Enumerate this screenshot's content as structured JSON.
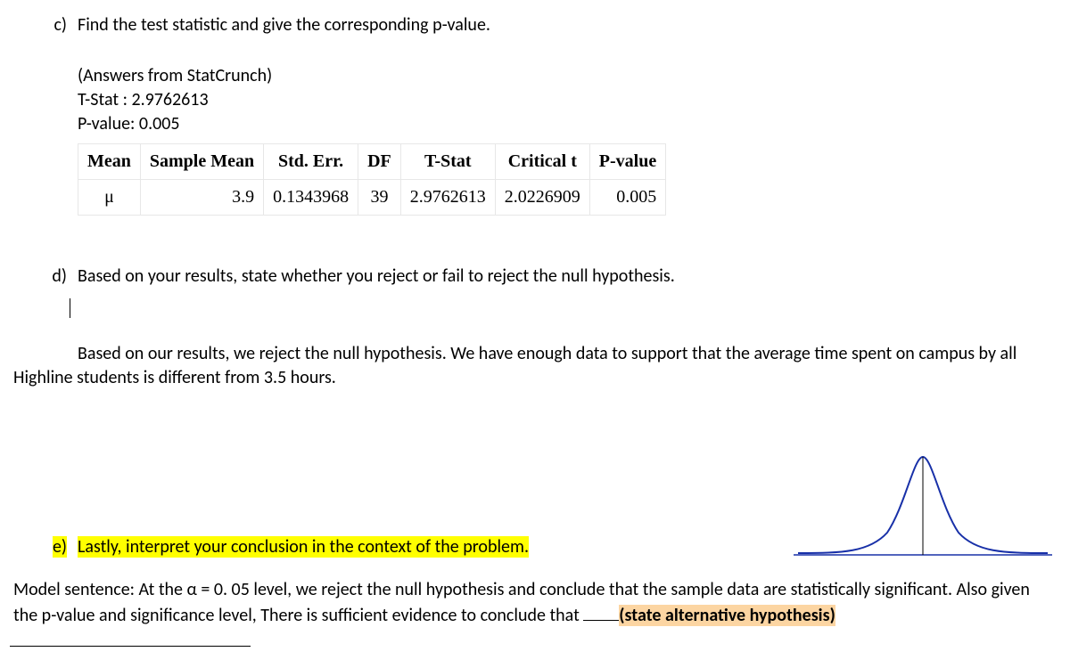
{
  "partC": {
    "label": "c)",
    "question": "Find the test statistic and give the corresponding p-value.",
    "ansHeader": "(Answers from StatCrunch)",
    "tstatLine": "T-Stat : 2.9762613",
    "pvalLine": "P-value: 0.005"
  },
  "table": {
    "headers": [
      "Mean",
      "Sample Mean",
      "Std. Err.",
      "DF",
      "T-Stat",
      "Critical t",
      "P-value"
    ],
    "row": [
      "μ",
      "3.9",
      "0.1343968",
      "39",
      "2.9762613",
      "2.0226909",
      "0.005"
    ]
  },
  "partD": {
    "label": "d)",
    "question": "Based on your results, state whether you reject or fail to reject the null hypothesis.",
    "answer": "Based on our results, we reject the null hypothesis. We have enough data to support that the average time spent on campus by all Highline students is different from 3.5 hours."
  },
  "partE": {
    "label": "e)",
    "question": "Lastly, interpret your conclusion in the context of the problem."
  },
  "model": {
    "lead": "Model sentence:  At the α =  0. 05  level, we reject the null hypothesis and conclude that the sample data are statistically significant. Also given the p-value and significance level, There is sufficient evidence to conclude that ",
    "altHyp": "(state alternative hypothesis)"
  }
}
